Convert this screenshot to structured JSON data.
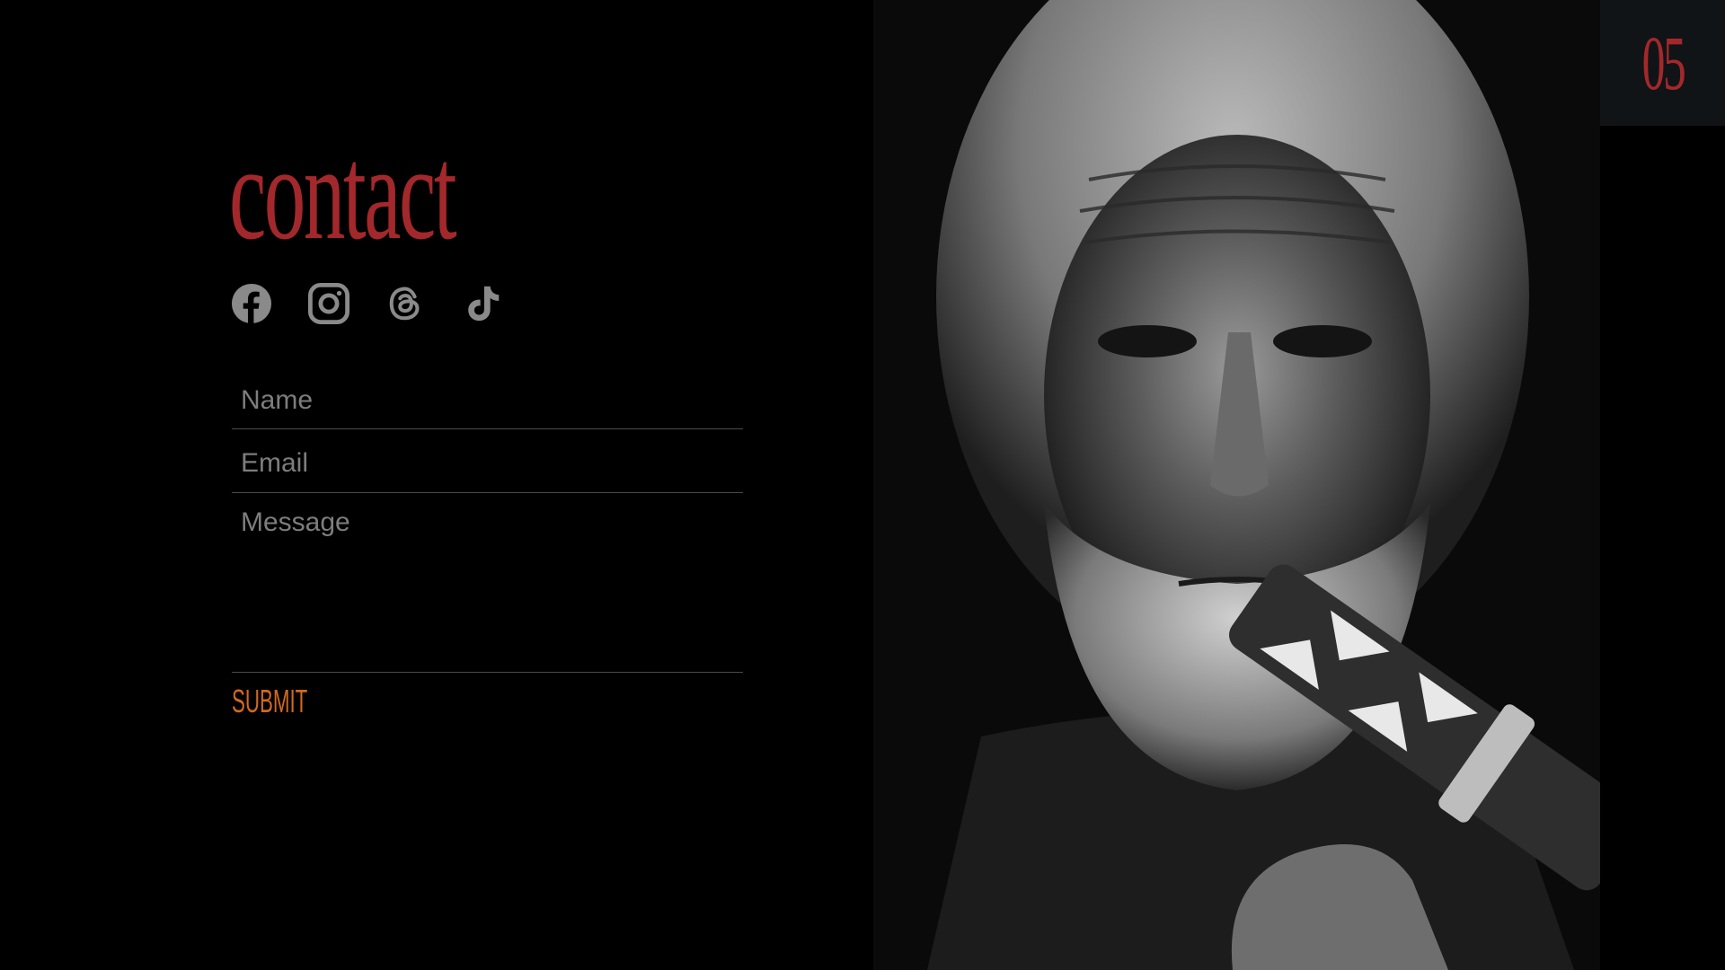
{
  "section": {
    "title": "contact",
    "page_number": "05"
  },
  "socials": [
    {
      "name": "facebook",
      "icon": "facebook-icon"
    },
    {
      "name": "instagram",
      "icon": "instagram-icon"
    },
    {
      "name": "threads",
      "icon": "threads-icon"
    },
    {
      "name": "tiktok",
      "icon": "tiktok-icon"
    }
  ],
  "form": {
    "name_placeholder": "Name",
    "name_value": "",
    "email_placeholder": "Email",
    "email_value": "",
    "message_placeholder": "Message",
    "message_value": "",
    "submit_label": "SUBMIT"
  },
  "colors": {
    "background": "#000000",
    "title": "#a3282c",
    "social_icons": "#8a8a8a",
    "placeholder": "#7d7d7d",
    "divider": "#4a4a4a",
    "submit": "#d2691e",
    "badge_bg": "#111416"
  },
  "portrait": {
    "icon": "portrait-image"
  }
}
